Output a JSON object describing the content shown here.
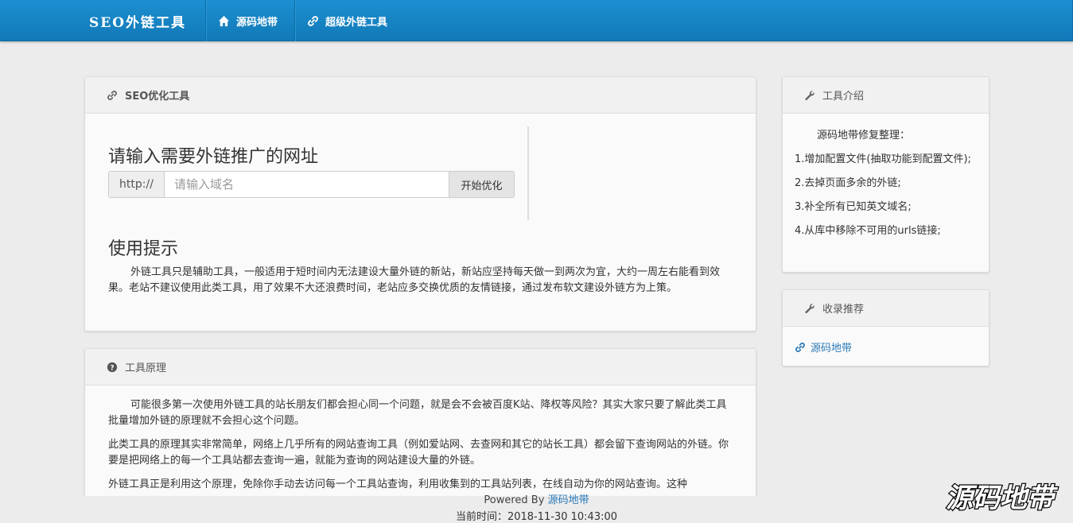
{
  "navbar": {
    "brand": "SEO外链工具",
    "items": [
      {
        "label": "源码地带",
        "icon": "home-icon"
      },
      {
        "label": "超级外链工具",
        "icon": "link-icon"
      }
    ]
  },
  "seo_panel": {
    "header": "SEO优化工具",
    "prompt_title": "请输入需要外链推广的网址",
    "input_prefix": "http://",
    "input_placeholder": "请输入域名",
    "input_value": "",
    "submit_label": "开始优化",
    "tips_title": "使用提示",
    "tips_text": "外链工具只是辅助工具，一般适用于短时间内无法建设大量外链的新站，新站应坚持每天做一到两次为宜，大约一周左右能看到效果。老站不建议使用此类工具，用了效果不大还浪费时间，老站应多交换优质的友情链接，通过发布软文建设外链方为上策。"
  },
  "principle_panel": {
    "header": "工具原理",
    "paragraphs": [
      "可能很多第一次使用外链工具的站长朋友们都会担心同一个问题，就是会不会被百度K站、降权等风险？其实大家只要了解此类工具批量增加外链的原理就不会担心这个问题。",
      "此类工具的原理其实非常简单，网络上几乎所有的网站查询工具（例如爱站网、去查网和其它的站长工具）都会留下查询网站的外链。你要是把网络上的每一个工具站都去查询一遍，就能为查询的网站建设大量的外链。",
      "外链工具正是利用这个原理，免除你手动去访问每一个工具站查询，利用收集到的工具站列表，在线自动为你的网站查询。这种"
    ]
  },
  "intro_panel": {
    "header": "工具介绍",
    "lead": "源码地带修复整理：",
    "items": [
      "1.增加配置文件(抽取功能到配置文件);",
      "2.去掉页面多余的外链;",
      "3.补全所有已知英文域名;",
      "4.从库中移除不可用的urls链接;"
    ]
  },
  "recommend_panel": {
    "header": "收录推荐",
    "link_label": "源码地带"
  },
  "footer": {
    "powered_prefix": "Powered By ",
    "powered_link": "源码地带",
    "time_label": "当前时间：2018-11-30 10:43:00"
  },
  "watermark": {
    "text": "源码地带"
  },
  "colors": {
    "navbar": "#1a86c6",
    "link": "#2a7ab8",
    "background": "#ececec"
  }
}
